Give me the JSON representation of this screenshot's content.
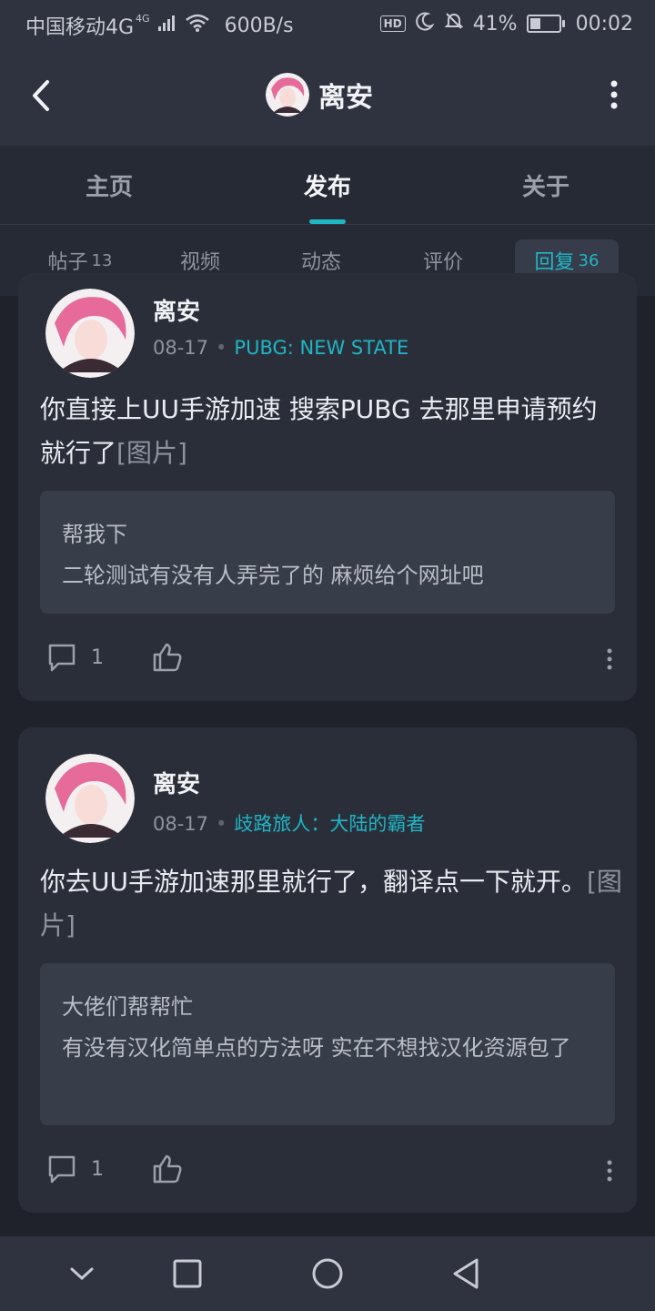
{
  "status_bar": {
    "carrier": "中国移动4G",
    "network_badge": "4G",
    "speed": "600B/s",
    "hd_badge": "HD",
    "battery": "41%",
    "battery_level": 0.41,
    "time": "00:02"
  },
  "header": {
    "title": "离安",
    "back_icon": "chevron-left-icon",
    "more_icon": "more-vertical-icon"
  },
  "tabs": [
    {
      "label": "主页",
      "active": false
    },
    {
      "label": "发布",
      "active": true
    },
    {
      "label": "关于",
      "active": false
    }
  ],
  "accent_color": "#1fb6c6",
  "subtabs": [
    {
      "label": "帖子",
      "count": "13",
      "active": false
    },
    {
      "label": "视频",
      "count": "",
      "active": false
    },
    {
      "label": "动态",
      "count": "",
      "active": false
    },
    {
      "label": "评价",
      "count": "",
      "active": false
    },
    {
      "label": "回复",
      "count": "36",
      "active": true
    }
  ],
  "posts": [
    {
      "author": "离安",
      "date": "08-17",
      "separator": "•",
      "game": "PUBG: NEW STATE",
      "content": "你直接上UU手游加速 搜索PUBG 去那里申请预约就行了",
      "image_tag": "[图片]",
      "quote_title": "帮我下",
      "quote_text": "二轮测试有没有人弄完了的 麻烦给个网址吧",
      "comment_count": "1"
    },
    {
      "author": "离安",
      "date": "08-17",
      "separator": "•",
      "game": "歧路旅人：大陆的霸者",
      "content": "你去UU手游加速那里就行了，翻译点一下就开。",
      "image_tag": "[图片]",
      "quote_title": "大佬们帮帮忙",
      "quote_text": "有没有汉化简单点的方法呀 实在不想找汉化资源包了",
      "comment_count": "1"
    }
  ],
  "nav_bar": {
    "icons": [
      "chevron-down-icon",
      "square-icon",
      "circle-icon",
      "triangle-back-icon"
    ]
  }
}
